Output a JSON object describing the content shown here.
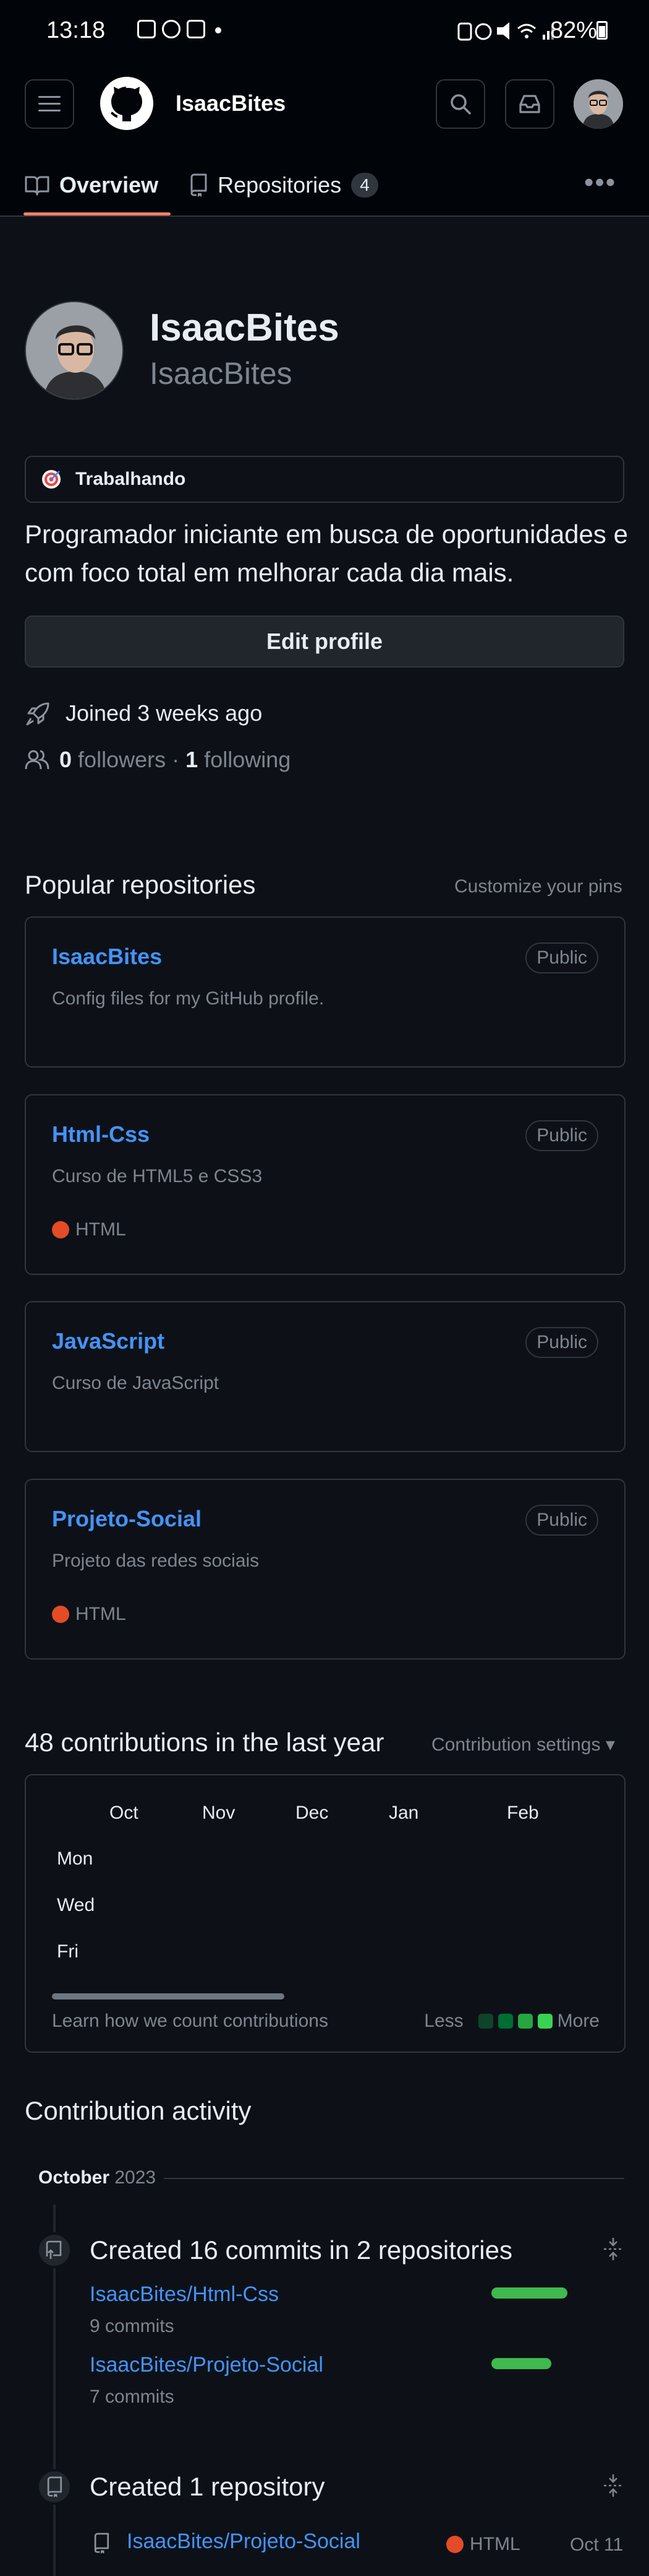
{
  "status_bar": {
    "time": "13:18",
    "battery": "82%"
  },
  "header": {
    "username": "IsaacBites",
    "icons": [
      "hamburger-menu-icon",
      "github-logo-icon",
      "search-icon",
      "inbox-icon"
    ]
  },
  "tabs": [
    {
      "label": "Overview",
      "active": true,
      "icon": "book-icon"
    },
    {
      "label": "Repositories",
      "count": "4",
      "icon": "repo-icon"
    }
  ],
  "profile": {
    "name": "IsaacBites",
    "login": "IsaacBites",
    "status": "Trabalhando",
    "bio": "Programador iniciante em busca de oportunidades e com foco total em melhorar cada dia mais.",
    "edit_label": "Edit profile",
    "joined": "Joined 3 weeks ago",
    "followers_count": "0",
    "followers_label": "followers",
    "separator": "·",
    "following_count": "1",
    "following_label": "following"
  },
  "popular": {
    "title": "Popular repositories",
    "customize": "Customize your pins",
    "repos": [
      {
        "name": "IsaacBites",
        "badge": "Public",
        "desc": "Config files for my GitHub profile.",
        "lang": ""
      },
      {
        "name": "Html-Css",
        "badge": "Public",
        "desc": "Curso de HTML5 e CSS3",
        "lang": "HTML"
      },
      {
        "name": "JavaScript",
        "badge": "Public",
        "desc": "Curso de JavaScript",
        "lang": ""
      },
      {
        "name": "Projeto-Social",
        "badge": "Public",
        "desc": "Projeto das redes sociais",
        "lang": "HTML"
      }
    ]
  },
  "contributions": {
    "title": "48 contributions in the last year",
    "settings": "Contribution settings ▾",
    "months": [
      "Oct",
      "Nov",
      "Dec",
      "Jan",
      "Feb"
    ],
    "days": [
      "Mon",
      "Wed",
      "Fri"
    ],
    "learn": "Learn how we count contributions",
    "less": "Less",
    "more": "More",
    "legend_colors": [
      "#0e4429",
      "#006d32",
      "#26a641",
      "#39d353"
    ]
  },
  "activity": {
    "title": "Contribution activity",
    "month": "October",
    "year": "2023",
    "commits": {
      "title": "Created 16 commits in 2 repositories",
      "repos": [
        {
          "name": "IsaacBites/Html-Css",
          "count": "9 commits",
          "fraction": 0.56
        },
        {
          "name": "IsaacBites/Projeto-Social",
          "count": "7 commits",
          "fraction": 0.44
        }
      ]
    },
    "created": {
      "title": "Created 1 repository",
      "repo": "IsaacBites/Projeto-Social",
      "lang": "HTML",
      "date": "Oct 11"
    }
  },
  "colors": {
    "background": "#0d1117",
    "link": "#4493f8",
    "accent": "#f78166",
    "green": "#3fb950",
    "html_lang": "#e34c26"
  }
}
